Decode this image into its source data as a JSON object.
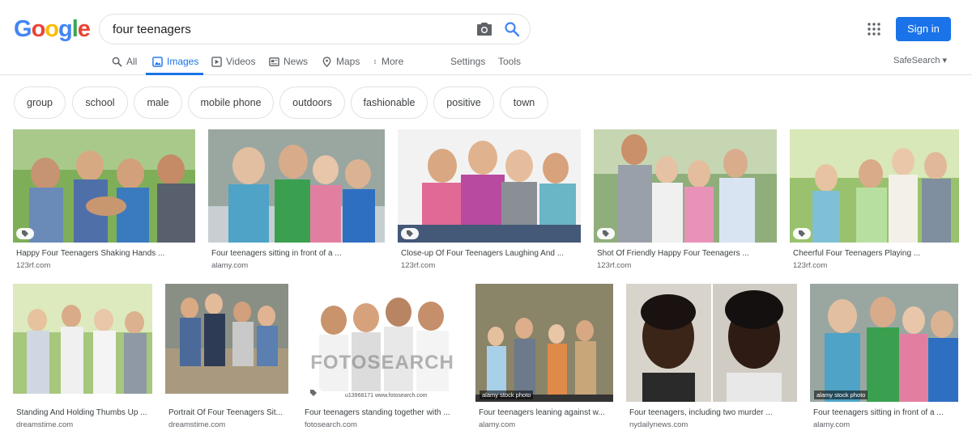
{
  "logo": {
    "letters": [
      "G",
      "o",
      "o",
      "g",
      "l",
      "e"
    ],
    "colors": [
      "#4285f4",
      "#ea4335",
      "#fbbc05",
      "#4285f4",
      "#34a853",
      "#ea4335"
    ]
  },
  "search": {
    "value": "four teenagers",
    "camera_icon": "camera-icon",
    "search_icon": "search-icon"
  },
  "header": {
    "apps_icon": "apps-grid-icon",
    "sign_in": "Sign in"
  },
  "tabs": [
    {
      "label": "All",
      "icon": "search-icon"
    },
    {
      "label": "Images",
      "icon": "image-icon"
    },
    {
      "label": "Videos",
      "icon": "video-icon"
    },
    {
      "label": "News",
      "icon": "news-icon"
    },
    {
      "label": "Maps",
      "icon": "map-pin-icon"
    },
    {
      "label": "More",
      "icon": "more-vert-icon"
    },
    {
      "label": "Settings"
    },
    {
      "label": "Tools"
    }
  ],
  "active_tab": "Images",
  "safesearch": "SafeSearch ▾",
  "chips": [
    "group",
    "school",
    "male",
    "mobile phone",
    "outdoors",
    "fashionable",
    "positive",
    "town"
  ],
  "results": [
    {
      "title": "Happy Four Teenagers Shaking Hands ...",
      "source": "123rf.com"
    },
    {
      "title": "Four teenagers sitting in front of a ...",
      "source": "alamy.com"
    },
    {
      "title": "Close-up Of Four Teenagers Laughing And ...",
      "source": "123rf.com"
    },
    {
      "title": "Shot Of Friendly Happy Four Teenagers ...",
      "source": "123rf.com"
    },
    {
      "title": "Cheerful Four Teenagers Playing ...",
      "source": "123rf.com"
    },
    {
      "title": "Standing And Holding Thumbs Up ...",
      "source": "dreamstime.com"
    },
    {
      "title": "Portrait Of Four Teenagers Sit...",
      "source": "dreamstime.com"
    },
    {
      "title": "Four teenagers standing together with ...",
      "source": "fotosearch.com",
      "watermark": "FOTOSEARCH",
      "caption": "u13968171 www.fotosearch.com"
    },
    {
      "title": "Four teenagers leaning against w...",
      "source": "alamy.com",
      "caption": "alamy stock photo"
    },
    {
      "title": "Four teenagers, including two murder ...",
      "source": "nydailynews.com"
    },
    {
      "title": "Four teenagers sitting in front of a ...",
      "source": "alamy.com",
      "caption": "alamy stock photo"
    }
  ]
}
